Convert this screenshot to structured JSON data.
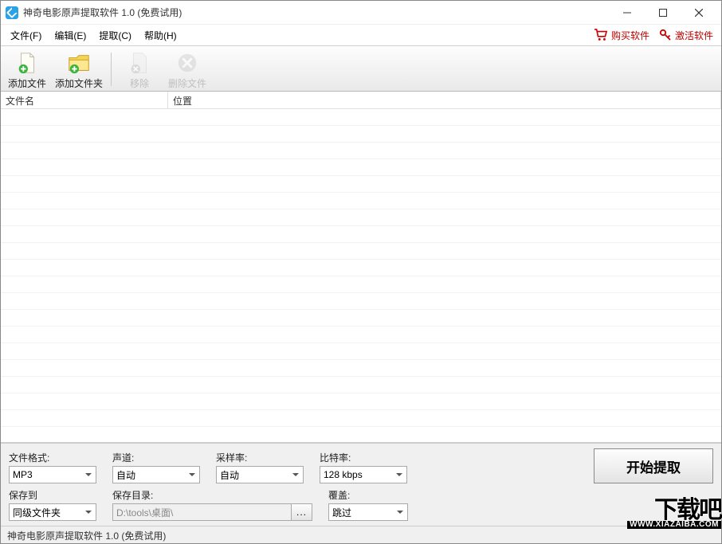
{
  "titlebar": {
    "text": "神奇电影原声提取软件 1.0 (免费试用)"
  },
  "menu": {
    "file": "文件(F)",
    "edit": "编辑(E)",
    "extract": "提取(C)",
    "help": "帮助(H)",
    "buy": "购买软件",
    "activate": "激活软件"
  },
  "toolbar": {
    "add_file": "添加文件",
    "add_folder": "添加文件夹",
    "remove": "移除",
    "delete_file": "删除文件"
  },
  "list": {
    "col_name": "文件名",
    "col_location": "位置"
  },
  "form": {
    "format_label": "文件格式:",
    "format_value": "MP3",
    "channel_label": "声道:",
    "channel_value": "自动",
    "samplerate_label": "采样率:",
    "samplerate_value": "自动",
    "bitrate_label": "比特率:",
    "bitrate_value": "128 kbps",
    "saveto_label": "保存到",
    "saveto_value": "同级文件夹",
    "savedir_label": "保存目录:",
    "savedir_value": "D:\\tools\\桌面\\",
    "browse": "...",
    "overwrite_label": "覆盖:",
    "overwrite_value": "跳过",
    "start": "开始提取"
  },
  "statusbar": {
    "text": "神奇电影原声提取软件 1.0 (免费试用)"
  },
  "watermark": {
    "big": "下载吧",
    "url": "WWW.XIAZAIBA.COM"
  }
}
